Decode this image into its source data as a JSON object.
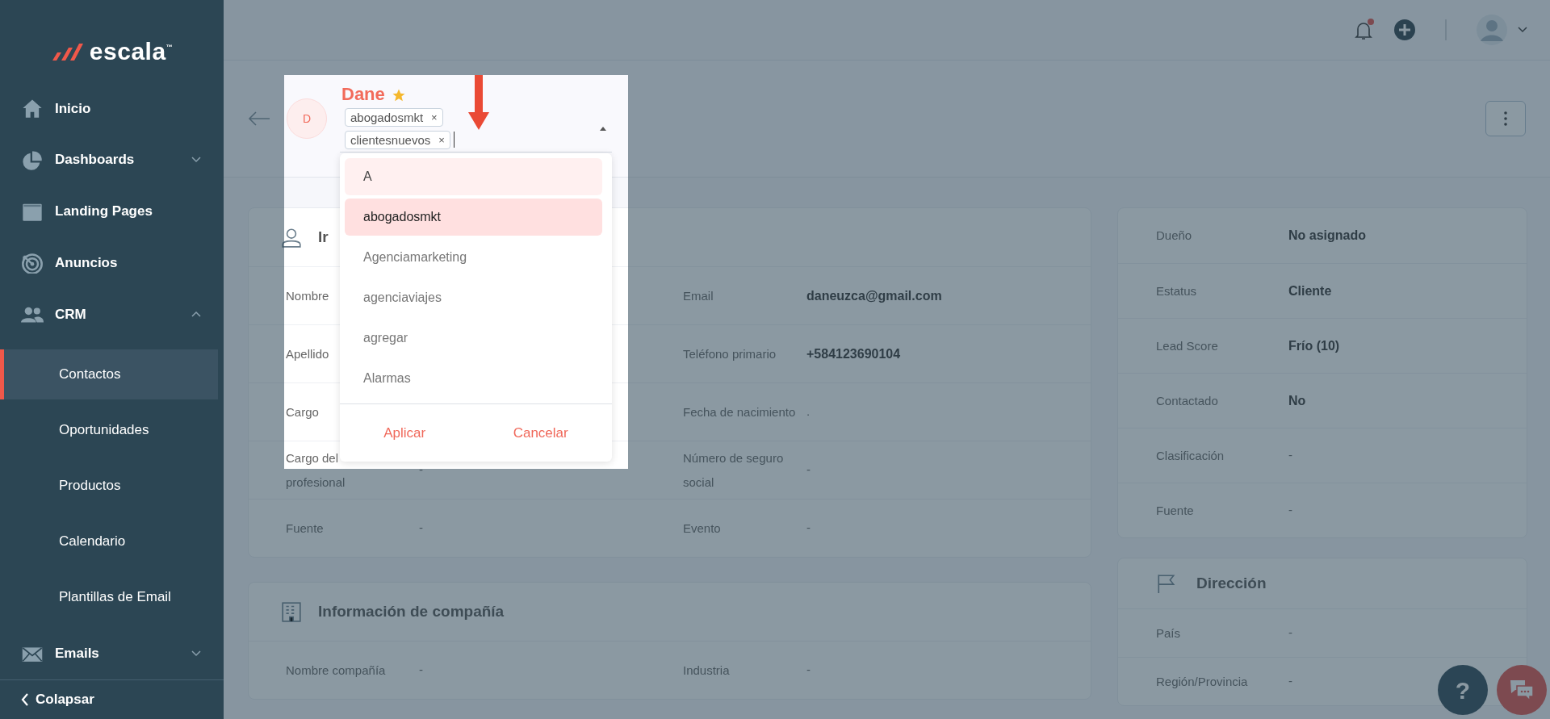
{
  "sidebar": {
    "logo": "escala$^{™}$",
    "items": [
      {
        "kind": "link",
        "label": "Inicio"
      },
      {
        "kind": "group",
        "label": "Dashboards",
        "expanded": false
      },
      {
        "kind": "link",
        "label": "Landing Pages"
      },
      {
        "kind": "link",
        "label": "Anuncios"
      },
      {
        "kind": "group",
        "label": "CRM",
        "expanded": true,
        "children": [
          {
            "label": "Contactos",
            "selected": true
          },
          {
            "label": "Oportunidades",
            "selected": false
          },
          {
            "label": "Productos",
            "selected": false
          },
          {
            "label": "Calendario",
            "selected": false
          },
          {
            "label": "Plantillas de Email",
            "selected": false
          }
        ]
      },
      {
        "kind": "group",
        "label": "Emails",
        "expanded": false
      }
    ],
    "collapse": "Colapsar"
  },
  "topbar": {
    "notifications_unread": true
  },
  "contact": {
    "initial": "D",
    "name": "Dane",
    "favorite": true,
    "tags": [
      {
        "label": "abogadosmkt",
        "remove": "×"
      },
      {
        "label": "clientesnuevos",
        "remove": "×"
      }
    ]
  },
  "tag_dropdown": {
    "options": [
      {
        "label": "A",
        "highlighted": true,
        "selected": false
      },
      {
        "label": "abogadosmkt",
        "highlighted": false,
        "selected": true
      },
      {
        "label": "Agenciamarketing",
        "highlighted": false,
        "selected": false
      },
      {
        "label": "agenciaviajes",
        "highlighted": false,
        "selected": false
      },
      {
        "label": "agregar",
        "highlighted": false,
        "selected": false
      },
      {
        "label": "Alarmas",
        "highlighted": false,
        "selected": false
      }
    ],
    "buttons": [
      "Aplicar",
      "Cancelar"
    ]
  },
  "contact_info": {
    "title": "Ir",
    "rows": [
      [
        {
          "label": "Nombre"
        },
        {
          "label": "Email",
          "value": "daneuzca@gmail.com",
          "bold": true
        }
      ],
      [
        {
          "label": "Apellido"
        },
        {
          "label": "Teléfono primario",
          "value": "+584123690104",
          "bold": true
        }
      ],
      [
        {
          "label": "Cargo"
        },
        {
          "label": "Fecha de nacimiento",
          "value": ".",
          "bold": false
        }
      ],
      [
        {
          "label": "Cargo del profesional",
          "value": "-",
          "bold": false
        },
        {
          "label": "Número de seguro social",
          "value": "-",
          "bold": false
        }
      ],
      [
        {
          "label": "Fuente",
          "value": "-",
          "bold": false
        },
        {
          "label": "Evento",
          "value": "-",
          "bold": false
        }
      ]
    ]
  },
  "company_info": {
    "title": "Información de compañía",
    "rows": [
      [
        {
          "label": "Nombre compañía",
          "value": "-",
          "bold": false
        },
        {
          "label": "Industria",
          "value": "-",
          "bold": false
        }
      ]
    ]
  },
  "summary": {
    "rows": [
      {
        "label": "Dueño",
        "value": "No asignado",
        "bold": true
      },
      {
        "label": "Estatus",
        "value": "Cliente",
        "bold": true
      },
      {
        "label": "Lead Score",
        "value": "Frío (10)",
        "bold": true
      },
      {
        "label": "Contactado",
        "value": "No",
        "bold": true
      },
      {
        "label": "Clasificación",
        "value": "-",
        "bold": false
      },
      {
        "label": "Fuente",
        "value": "-",
        "bold": false
      }
    ]
  },
  "address": {
    "title": "Dirección",
    "rows": [
      {
        "label": "País",
        "value": "-",
        "bold": false
      },
      {
        "label": "Región/Provincia",
        "value": "-",
        "bold": false
      }
    ]
  },
  "help_button": "?"
}
